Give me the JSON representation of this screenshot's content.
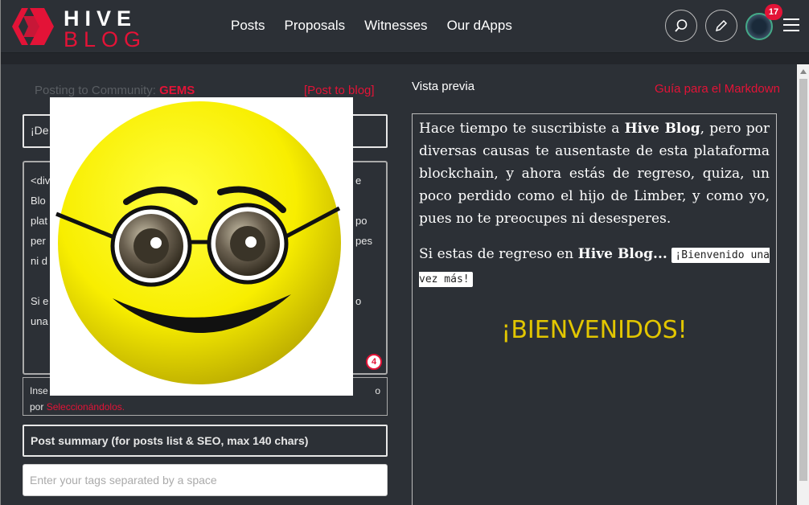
{
  "header": {
    "logo_top": "HIVE",
    "logo_bottom": "BLOG",
    "nav": [
      "Posts",
      "Proposals",
      "Witnesses",
      "Our dApps"
    ],
    "notifications": "17",
    "search_icon": "search-icon",
    "edit_icon": "pencil-icon",
    "menu_icon": "hamburger-icon"
  },
  "editor": {
    "posting_prefix": "Posting to Community: ",
    "community": "GEMS",
    "post_to_blog": "[Post to blog]",
    "title_value": "¡De",
    "body_lines": [
      "<div",
      "Blo",
      "plat",
      "per",
      "ni d",
      "",
      "Si e",
      "una"
    ],
    "body_fragments": [
      "e",
      "po",
      "pes",
      "o"
    ],
    "char_counter": "4",
    "insert_text": "Inse",
    "insert_text_end": "o",
    "insert_by": "por ",
    "insert_select": "Seleccionándolos.",
    "summary_placeholder": "Post summary (for posts list & SEO, max 140 chars)",
    "tags_placeholder": "Enter your tags separated by a space"
  },
  "preview": {
    "label": "Vista previa",
    "markdown_guide": "Guía para el Markdown",
    "p1_a": "Hace tiempo te suscribiste a ",
    "p1_b": "Hive Blog",
    "p1_c": ", pero por diversas causas te ausentaste de esta plataforma blockchain, y ahora estás de regreso, quiza, un poco perdido como el hijo de Limber, y como yo, pues no te preocupes ni desesperes.",
    "p2_a": "Si estas de regreso en ",
    "p2_b": "Hive Blog...",
    "p2_code": "¡Bienvenido una vez más!",
    "banner": "¡BIENVENIDOS!"
  },
  "colors": {
    "brand": "#e31337",
    "background": "#2c3036",
    "banner": "#e2c600"
  }
}
